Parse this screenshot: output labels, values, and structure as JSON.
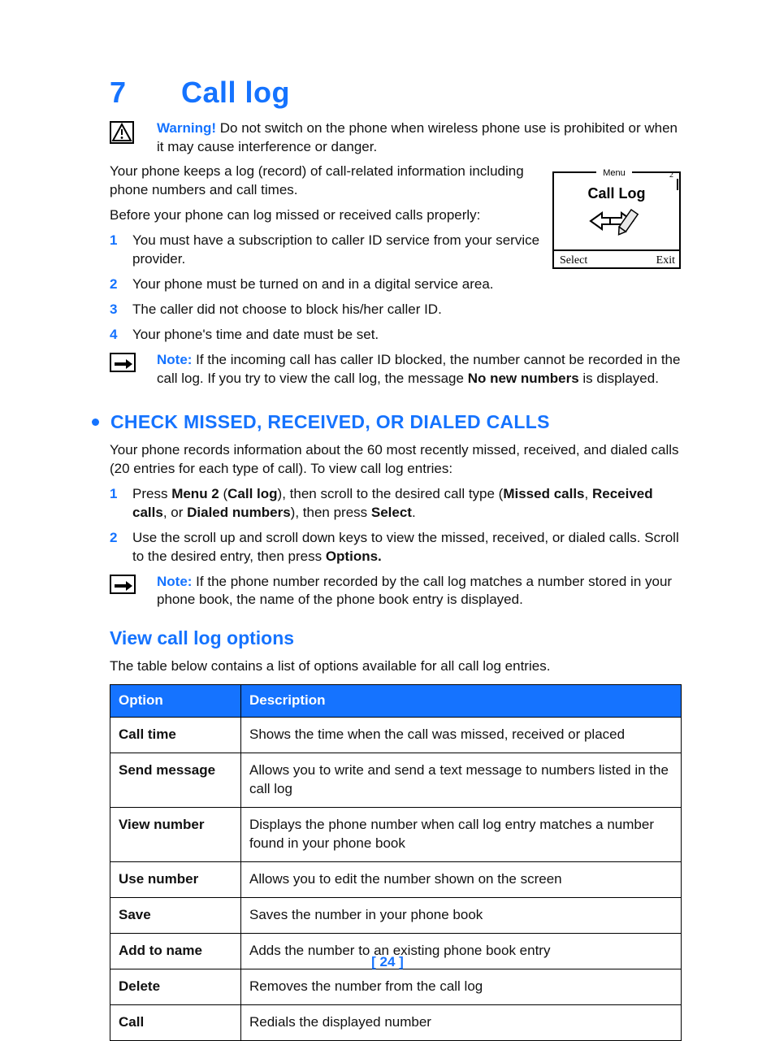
{
  "chapter": {
    "number": "7",
    "title": "Call log"
  },
  "warning": {
    "label": "Warning!",
    "text": " Do not switch on the phone when wireless phone use is prohibited or when it may cause interference or danger."
  },
  "intro1": "Your phone keeps a log (record) of call-related information including phone numbers and call times.",
  "intro2": "Before your phone can log missed or received calls properly:",
  "prereqs": [
    "You must have a subscription to caller ID service from your service provider.",
    "Your phone must be turned on and in a digital service area.",
    "The caller did not choose to block his/her caller ID.",
    "Your phone's time and date must be set."
  ],
  "note1": {
    "label": "Note:",
    "pre": " If the incoming call has caller ID blocked, the number cannot be recorded in the call log. If you try to view the call log, the message ",
    "bold": "No new numbers",
    "post": " is displayed."
  },
  "sec1_title": "CHECK MISSED, RECEIVED, OR DIALED CALLS",
  "sec1_intro": "Your phone records information about the 60 most recently missed, received, and dialed calls (20 entries for each type of call). To view call log entries:",
  "sec1_steps": {
    "s1": {
      "a": "Press ",
      "b1": "Menu 2",
      "c": " (",
      "b2": "Call log",
      "d": "), then scroll to the desired call type (",
      "b3": "Missed calls",
      "e": ", ",
      "b4": "Received calls",
      "f": ", or ",
      "b5": "Dialed numbers",
      "g": "), then press ",
      "b6": "Select",
      "h": "."
    },
    "s2": {
      "a": "Use the scroll up and scroll down keys to view the missed, received, or dialed calls. Scroll to the desired entry, then press ",
      "b1": "Options.",
      "c": ""
    }
  },
  "note2": {
    "label": "Note:",
    "text": " If the phone number recorded by the call log matches a number stored in your phone book, the name of the phone book entry is displayed."
  },
  "subhead": "View call log options",
  "sub_intro": "The table below contains a list of options available for all call log entries.",
  "table": {
    "h1": "Option",
    "h2": "Description",
    "rows": [
      {
        "opt": "Call time",
        "desc": "Shows the time when the call was missed, received or placed"
      },
      {
        "opt": "Send message",
        "desc": "Allows you to write and send a text message to numbers listed in the call log"
      },
      {
        "opt": "View number",
        "desc": "Displays the phone number when call log entry matches a number found in your phone book"
      },
      {
        "opt": "Use number",
        "desc": "Allows you to edit the number shown on the screen"
      },
      {
        "opt": "Save",
        "desc": "Saves the number in your phone book"
      },
      {
        "opt": "Add to name",
        "desc": "Adds the number to an existing phone book entry"
      },
      {
        "opt": "Delete",
        "desc": "Removes the number from the call log"
      },
      {
        "opt": "Call",
        "desc": "Redials the displayed number"
      }
    ]
  },
  "phone": {
    "menu": "Menu",
    "two": "2",
    "title": "Call Log",
    "select": "Select",
    "exit": "Exit"
  },
  "page_number": "[ 24 ]"
}
